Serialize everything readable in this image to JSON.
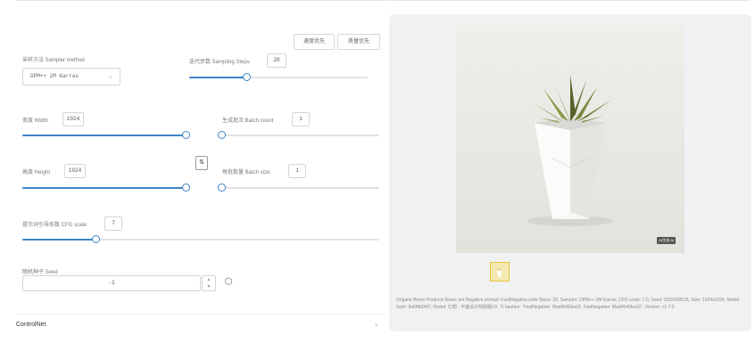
{
  "buttons": {
    "left_button": "速度优先",
    "right_button": "质量优先"
  },
  "sampler": {
    "label": "采样方法 Sampler method",
    "value": "DPM++ 2M Karras"
  },
  "steps": {
    "label": "迭代步数 Sampling Steps",
    "value": "20",
    "fraction": 0.31
  },
  "width": {
    "label": "宽度 Width",
    "value": "1024",
    "fraction": 1.0
  },
  "height": {
    "label": "高度 Height",
    "value": "1024",
    "fraction": 1.0
  },
  "batch_count": {
    "label": "生成批次 Batch count",
    "value": "1",
    "fraction": 0.0
  },
  "batch_size": {
    "label": "每批数量 Batch size",
    "value": "1",
    "fraction": 0.0
  },
  "cfg": {
    "label": "提示词引导系数 CFG scale",
    "value": "7",
    "fraction": 0.2
  },
  "seed": {
    "label": "随机种子 Seed",
    "value": "-1"
  },
  "controlnet": {
    "label": "ControlNet"
  },
  "icons": {
    "swap": "swap-icon",
    "dice": "dice-icon",
    "chevron": "chevron-down-icon",
    "arrow": "chevron-right-icon"
  },
  "preview": {
    "ai_badge": "AI生成 AI"
  },
  "generation_info": "Origami Home Products flower pot Negative prompt: FastNegative,nsfw Steps: 20, Sampler: DPM++ 2M Karras, CFG scale: 7.0, Seed: 2932428525, Size: 1024x1024, Model hash: 8a5f8b0f47, Model: 幻想 - 平面设计特别版V2, TI hashes: \"FastNegative: 8fad4540ba18, FastNegative: 8fad4540ba18\", Version: v1.7.0",
  "colors": {
    "accent": "#3d85c6",
    "panel_bg": "#f0f1f3",
    "selected_thumb_border": "#e8c63c"
  }
}
